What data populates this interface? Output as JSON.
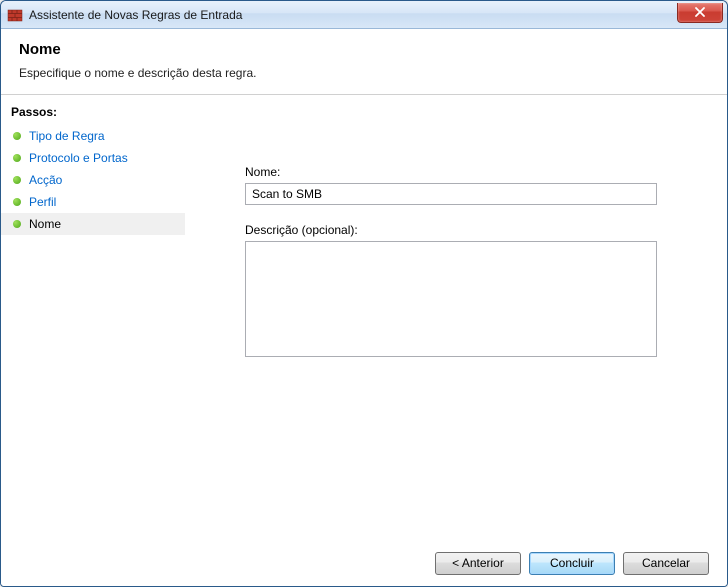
{
  "window": {
    "title": "Assistente de Novas Regras de Entrada"
  },
  "header": {
    "title": "Nome",
    "description": "Especifique o nome e descrição desta regra."
  },
  "sidebar": {
    "steps_label": "Passos:",
    "items": [
      {
        "label": "Tipo de Regra",
        "current": false
      },
      {
        "label": "Protocolo e Portas",
        "current": false
      },
      {
        "label": "Acção",
        "current": false
      },
      {
        "label": "Perfil",
        "current": false
      },
      {
        "label": "Nome",
        "current": true
      }
    ]
  },
  "form": {
    "name_label": "Nome:",
    "name_value": "Scan to SMB",
    "description_label": "Descrição (opcional):",
    "description_value": ""
  },
  "buttons": {
    "back": "< Anterior",
    "finish": "Concluir",
    "cancel": "Cancelar"
  }
}
